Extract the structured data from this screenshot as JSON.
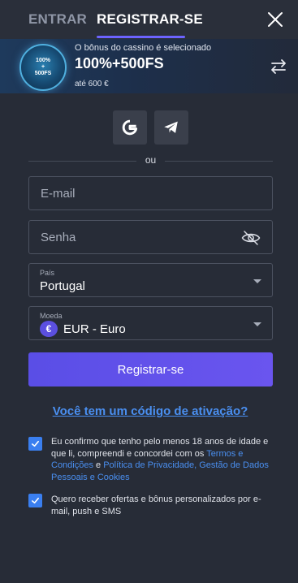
{
  "header": {
    "tab_login": "ENTRAR",
    "tab_register": "REGISTRAR-SE"
  },
  "bonus": {
    "selected_text": "O bônus do cassino é selecionado",
    "title": "100%+500FS",
    "limit": "até 600 €",
    "badge_line1": "100%",
    "badge_line2": "+",
    "badge_line3": "500FS"
  },
  "social": {
    "divider": "ou",
    "icons": [
      "google-icon",
      "telegram-icon"
    ]
  },
  "form": {
    "email_placeholder": "E-mail",
    "password_placeholder": "Senha",
    "country_label": "País",
    "country_value": "Portugal",
    "currency_label": "Moeda",
    "currency_symbol": "€",
    "currency_value": "EUR - Euro",
    "submit_label": "Registrar-se",
    "promo_link": "Você tem um código de ativação?"
  },
  "consent": {
    "terms_prefix": "Eu confirmo que tenho pelo menos 18 anos de idade e que li, compreendi e concordei com os ",
    "terms_link": "Termos e Condições",
    "terms_and": " e ",
    "privacy_link": "Política de Privacidade, Gestão de Dados Pessoais e Cookies",
    "terms_checked": true,
    "offers_text": "Quero receber ofertas e bônus personalizados por e-mail, push e SMS",
    "offers_checked": true
  },
  "colors": {
    "background": "#272c37",
    "accent": "#5a4ee6",
    "link": "#4a8ff0"
  }
}
